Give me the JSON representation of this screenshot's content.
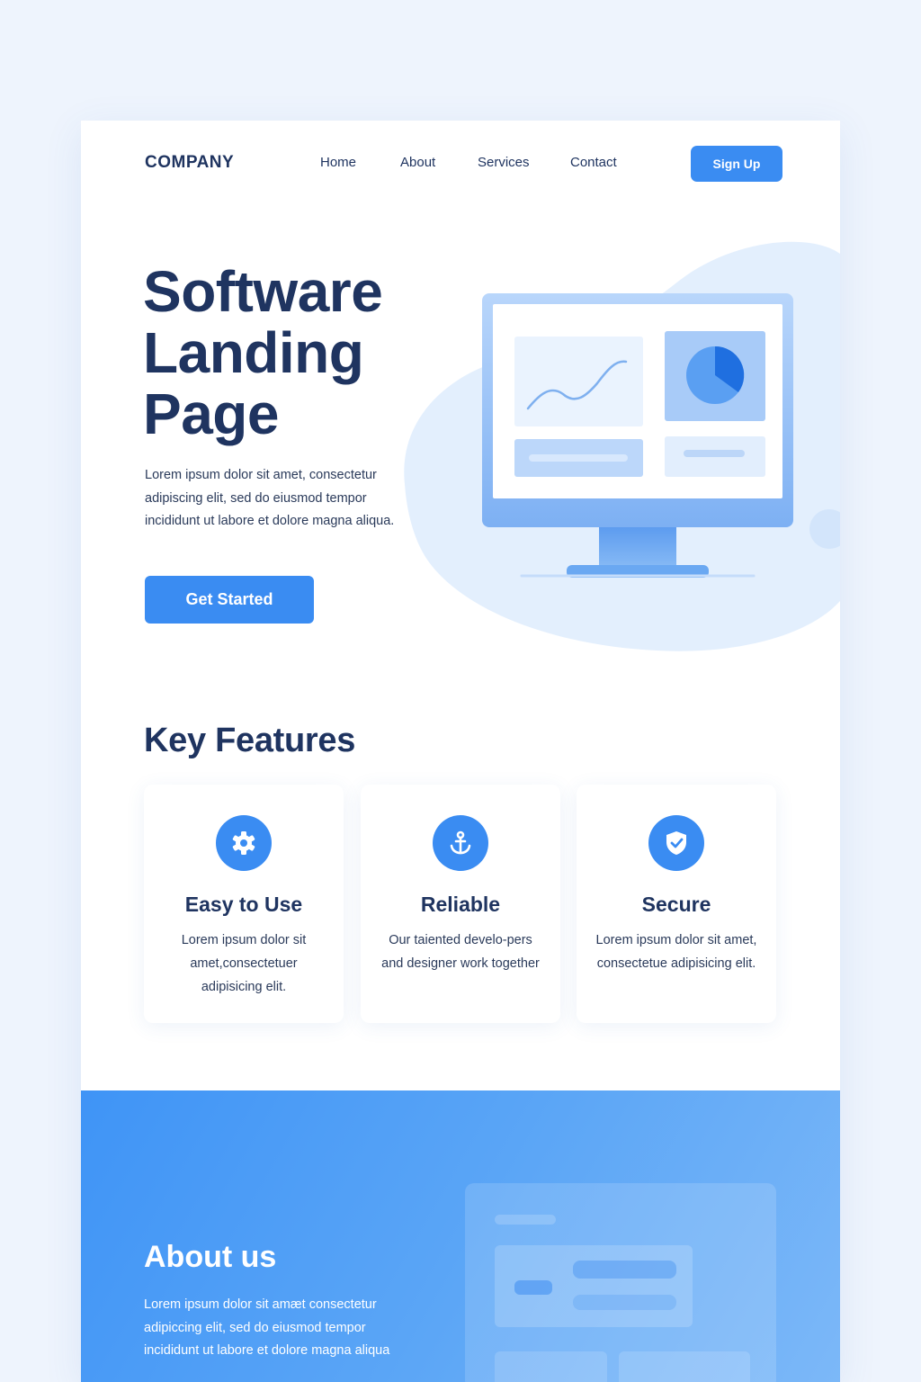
{
  "header": {
    "logo": "COMPANY",
    "nav": [
      "Home",
      "About",
      "Services",
      "Contact"
    ],
    "signup_label": "Sign Up"
  },
  "hero": {
    "title_lines": [
      "Software",
      "Landing",
      "Page"
    ],
    "description": "Lorem ipsum dolor sit amet, consectetur adipiscing elit, sed do eiusmod tempor incididunt ut labore et dolore magna aliqua.",
    "cta_label": "Get Started"
  },
  "features": {
    "title": "Key Features",
    "cards": [
      {
        "icon": "gear-icon",
        "title": "Easy to Use",
        "text": "Lorem ipsum dolor sit amet,consectetuer adipisicing elit."
      },
      {
        "icon": "anchor-icon",
        "title": "Reliable",
        "text": "Our taiented develo-pers and designer work together"
      },
      {
        "icon": "shield-check-icon",
        "title": "Secure",
        "text": "Lorem ipsum dolor sit amet, consectetue adipisicing elit."
      }
    ]
  },
  "about": {
    "title": "About us",
    "description": "Lorem ipsum dolor sit amæt consectetur adipiccing elit, sed do eiusmod tempor incididunt ut labore et dolore magna aliqua"
  },
  "colors": {
    "primary": "#3a8cf2",
    "heading": "#1f3460",
    "page_background": "#eef4fd",
    "blob": "#e3effd"
  }
}
